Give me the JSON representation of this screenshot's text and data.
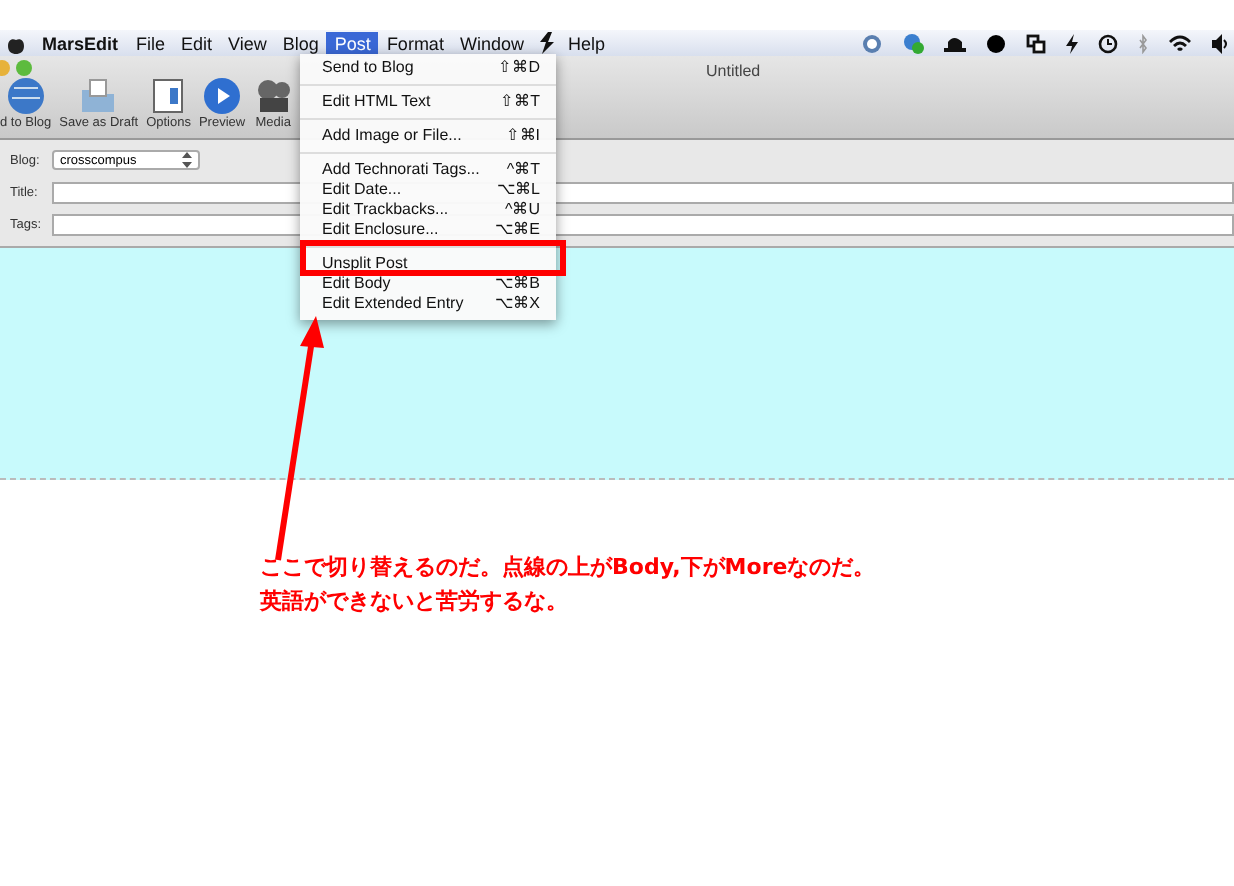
{
  "menu_bar": {
    "app": "MarsEdit",
    "menus": [
      {
        "label": "File",
        "selected": false
      },
      {
        "label": "Edit",
        "selected": false
      },
      {
        "label": "View",
        "selected": false
      },
      {
        "label": "Blog",
        "selected": false
      },
      {
        "label": "Post",
        "selected": true
      },
      {
        "label": "Format",
        "selected": false
      },
      {
        "label": "Window",
        "selected": false
      },
      {
        "label": "Help",
        "selected": false
      }
    ]
  },
  "window": {
    "title": "Untitled"
  },
  "toolbar": [
    {
      "label": "d to Blog",
      "kind": "send"
    },
    {
      "label": "Save as Draft",
      "kind": "draft"
    },
    {
      "label": "Options",
      "kind": "options"
    },
    {
      "label": "Preview",
      "kind": "preview"
    },
    {
      "label": "Media",
      "kind": "media"
    }
  ],
  "form": {
    "blog_label": "Blog:",
    "blog_value": "crosscompus",
    "title_label": "Title:",
    "tags_label": "Tags:"
  },
  "post_menu": [
    [
      {
        "label": "Send to Blog",
        "shortcut": "⇧⌘D"
      }
    ],
    [
      {
        "label": "Edit HTML Text",
        "shortcut": "⇧⌘T"
      }
    ],
    [
      {
        "label": "Add Image or File...",
        "shortcut": "⇧⌘I"
      }
    ],
    [
      {
        "label": "Add Technorati Tags...",
        "shortcut": "^⌘T"
      },
      {
        "label": "Edit Date...",
        "shortcut": "⌥⌘L"
      },
      {
        "label": "Edit Trackbacks...",
        "shortcut": "^⌘U"
      },
      {
        "label": "Edit Enclosure...",
        "shortcut": "⌥⌘E"
      }
    ],
    [
      {
        "label": "Unsplit Post"
      },
      {
        "label": "Edit Body",
        "shortcut": "⌥⌘B"
      },
      {
        "label": "Edit Extended Entry",
        "shortcut": "⌥⌘X"
      }
    ]
  ],
  "annotation": [
    "ここで切り替えるのだ。点線の上がBody,下がMoreなのだ。",
    "英語ができないと苦労するな。"
  ]
}
